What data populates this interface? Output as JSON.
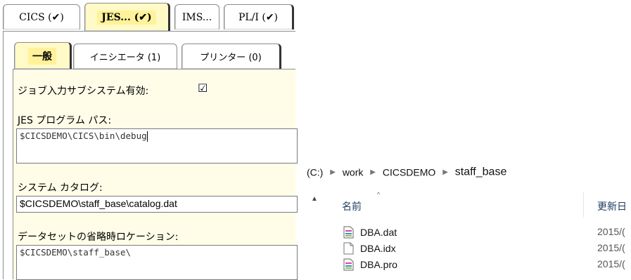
{
  "config": {
    "top_tabs": [
      {
        "label": "CICS (✔)",
        "active": false
      },
      {
        "label": "JES... (✔)",
        "active": true
      },
      {
        "label": "IMS...",
        "active": false
      },
      {
        "label": "PL/I (✔)",
        "active": false
      }
    ],
    "sub_tabs": [
      {
        "label": "一般",
        "active": true
      },
      {
        "label": "イニシエータ (1)",
        "active": false
      },
      {
        "label": "プリンター (0)",
        "active": false
      }
    ],
    "jes_enabled_label": "ジョブ入力サブシステム有効:",
    "jes_enabled_checked": "☑",
    "jes_path_label": "JES プログラム パス:",
    "jes_path_value": "$CICSDEMO\\CICS\\bin\\debug",
    "catalog_label": "システム カタログ:",
    "catalog_value": "$CICSDEMO\\staff_base\\catalog.dat",
    "dataset_label": "データセットの省略時ロケーション:",
    "dataset_value": "$CICSDEMO\\staff_base\\"
  },
  "explorer": {
    "breadcrumb": [
      "(C:)",
      "work",
      "CICSDEMO",
      "staff_base"
    ],
    "sep_icon": "breadcrumb-arrow-icon",
    "columns": {
      "name": "名前",
      "modified": "更新日"
    },
    "files": [
      {
        "name": "DBA.dat",
        "date": "2015/(",
        "icon": "dat-file-icon"
      },
      {
        "name": "DBA.idx",
        "date": "2015/(",
        "icon": "blank-file-icon"
      },
      {
        "name": "DBA.pro",
        "date": "2015/(",
        "icon": "dat-file-icon"
      }
    ]
  }
}
